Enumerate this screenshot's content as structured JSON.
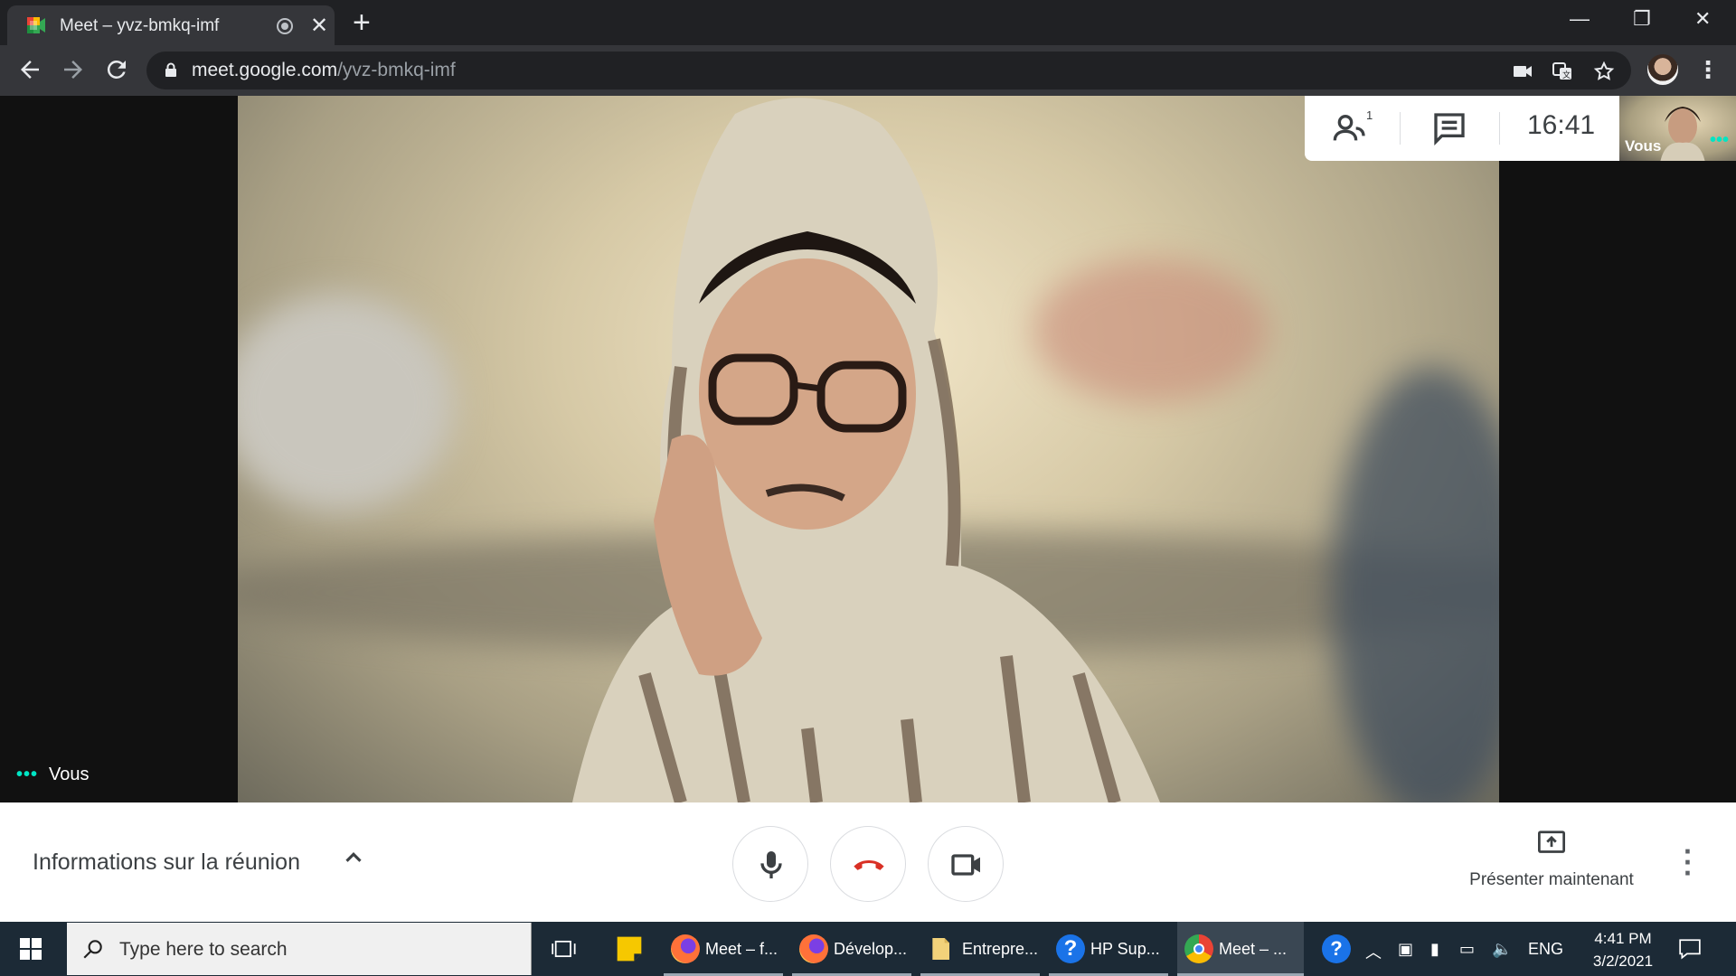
{
  "browser": {
    "tab_title": "Meet – yvz-bmkq-imf",
    "tab_close": "✕",
    "new_tab": "+",
    "url_host": "meet.google.com",
    "url_path": "/yvz-bmkq-imf",
    "window_minimize": "—",
    "window_restore": "❐",
    "window_close": "✕"
  },
  "meet": {
    "participants_count": "1",
    "clock": "16:41",
    "self_tile_label": "Vous",
    "main_label": "Vous",
    "meeting_info": "Informations sur la réunion",
    "present_label": "Présenter maintenant"
  },
  "taskbar": {
    "search_placeholder": "Type here to search",
    "items": [
      {
        "label": "Meet – f...",
        "icon": "firefox-icon"
      },
      {
        "label": "Dévelop...",
        "icon": "firefox-icon"
      },
      {
        "label": "Entrepre...",
        "icon": "folder-icon"
      },
      {
        "label": "HP Sup...",
        "icon": "help-icon"
      },
      {
        "label": "Meet – ...",
        "icon": "chrome-icon"
      }
    ],
    "language": "ENG",
    "time": "4:41 PM",
    "date": "3/2/2021"
  },
  "colors": {
    "accent_teal": "#00e5c4",
    "hangup_red": "#d93025",
    "chrome_dark": "#202124"
  }
}
